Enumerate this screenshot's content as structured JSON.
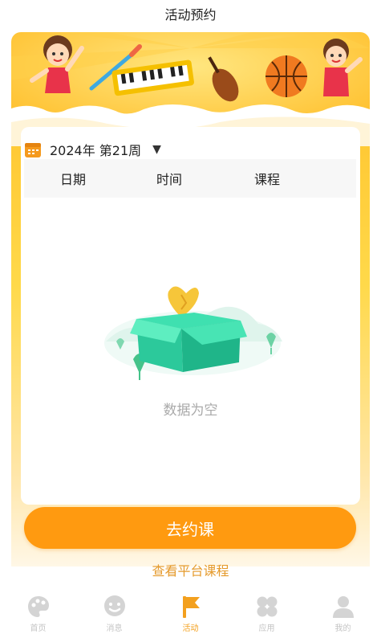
{
  "header": {
    "title": "活动预约"
  },
  "schedule": {
    "week_label": "2024年 第21周",
    "columns": [
      "日期",
      "时间",
      "课程"
    ]
  },
  "empty_state": {
    "text": "数据为空"
  },
  "actions": {
    "book_label": "去约课",
    "view_courses_label": "查看平台课程"
  },
  "tabbar": {
    "items": [
      {
        "label": "首页",
        "icon": "palette-icon",
        "active": false
      },
      {
        "label": "消息",
        "icon": "smiley-chat-icon",
        "active": false
      },
      {
        "label": "活动",
        "icon": "flag-icon",
        "active": true
      },
      {
        "label": "应用",
        "icon": "apps-grid-icon",
        "active": false
      },
      {
        "label": "我的",
        "icon": "user-icon",
        "active": false
      }
    ]
  },
  "colors": {
    "accent": "#ff9a10",
    "active_tab": "#f3a01e",
    "inactive_tab": "#c4c4c4",
    "panel_top": "#ffc42e"
  }
}
